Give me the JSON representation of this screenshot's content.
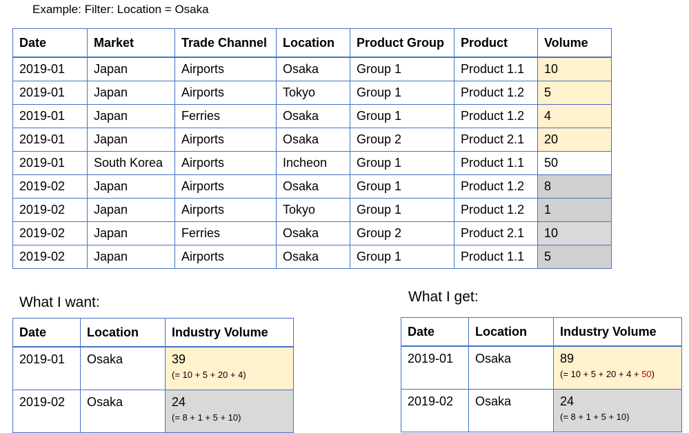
{
  "caption": "Example: Filter: Location = Osaka",
  "main_table": {
    "headers": [
      "Date",
      "Market",
      "Trade Channel",
      "Location",
      "Product Group",
      "Product",
      "Volume"
    ],
    "rows": [
      [
        "2019-01",
        "Japan",
        "Airports",
        "Osaka",
        "Group 1",
        "Product 1.1",
        "10"
      ],
      [
        "2019-01",
        "Japan",
        "Airports",
        "Tokyo",
        "Group 1",
        "Product 1.2",
        "5"
      ],
      [
        "2019-01",
        "Japan",
        "Ferries",
        "Osaka",
        "Group 1",
        "Product 1.2",
        "4"
      ],
      [
        "2019-01",
        "Japan",
        "Airports",
        "Osaka",
        "Group 2",
        "Product 2.1",
        "20"
      ],
      [
        "2019-01",
        "South Korea",
        "Airports",
        "Incheon",
        "Group 1",
        "Product 1.1",
        "50"
      ],
      [
        "2019-02",
        "Japan",
        "Airports",
        "Osaka",
        "Group 1",
        "Product 1.2",
        "8"
      ],
      [
        "2019-02",
        "Japan",
        "Airports",
        "Tokyo",
        "Group 1",
        "Product 1.2",
        "1"
      ],
      [
        "2019-02",
        "Japan",
        "Ferries",
        "Osaka",
        "Group 2",
        "Product 2.1",
        "10"
      ],
      [
        "2019-02",
        "Japan",
        "Airports",
        "Osaka",
        "Group 1",
        "Product 1.1",
        "5"
      ]
    ]
  },
  "want": {
    "heading": "What I want:",
    "headers": [
      "Date",
      "Location",
      "Industry Volume"
    ],
    "rows": [
      {
        "date": "2019-01",
        "location": "Osaka",
        "volume": "39",
        "formula": "(= 10 + 5 + 20 + 4)"
      },
      {
        "date": "2019-02",
        "location": "Osaka",
        "volume": "24",
        "formula": "(= 8 + 1 + 5 + 10)"
      }
    ]
  },
  "get": {
    "heading": "What I get:",
    "headers": [
      "Date",
      "Location",
      "Industry Volume"
    ],
    "rows": [
      {
        "date": "2019-01",
        "location": "Osaka",
        "volume": "89",
        "formula": "(= 10 + 5 + 20 + 4 + ",
        "formula_extra": "50",
        "formula_end": ")"
      },
      {
        "date": "2019-02",
        "location": "Osaka",
        "volume": "24",
        "formula": "(= 8 + 1 + 5 + 10)"
      }
    ]
  },
  "colors": {
    "border": "#4472c4",
    "highlight_2019_01": "#fff2cc",
    "highlight_2019_02": "#d0d0d0",
    "extra_value": "#c00000"
  }
}
